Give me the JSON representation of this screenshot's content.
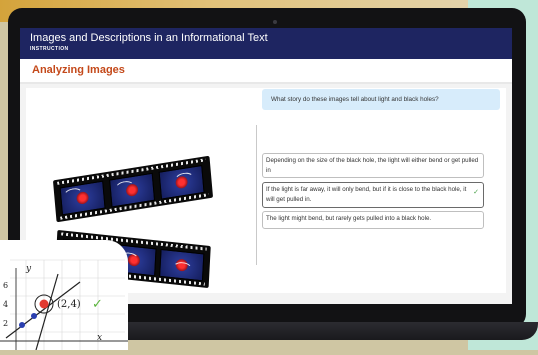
{
  "lesson": {
    "title": "Images and Descriptions in an Informational Text",
    "subtitle": "INSTRUCTION",
    "section": "Analyzing Images"
  },
  "question": "What story do these images tell about light and black holes?",
  "answers": [
    {
      "text": "Depending on the size of the black hole, the light will either bend or get pulled in",
      "selected": false
    },
    {
      "text": "If the light is far away, it will only bend, but if it is close to the black hole, it will get pulled in.",
      "selected": true
    },
    {
      "text": "The light might bend, but rarely gets pulled into a black hole.",
      "selected": false
    }
  ],
  "graph": {
    "y_axis": "y",
    "x_axis": "x",
    "y_ticks": [
      "6",
      "4",
      "2"
    ],
    "point_label": "(2,4)",
    "check": "✓"
  },
  "colors": {
    "header_bg": "#1e2561",
    "section_title": "#c4491a",
    "question_bg": "#d7ecfb",
    "check": "#4aa04a"
  }
}
